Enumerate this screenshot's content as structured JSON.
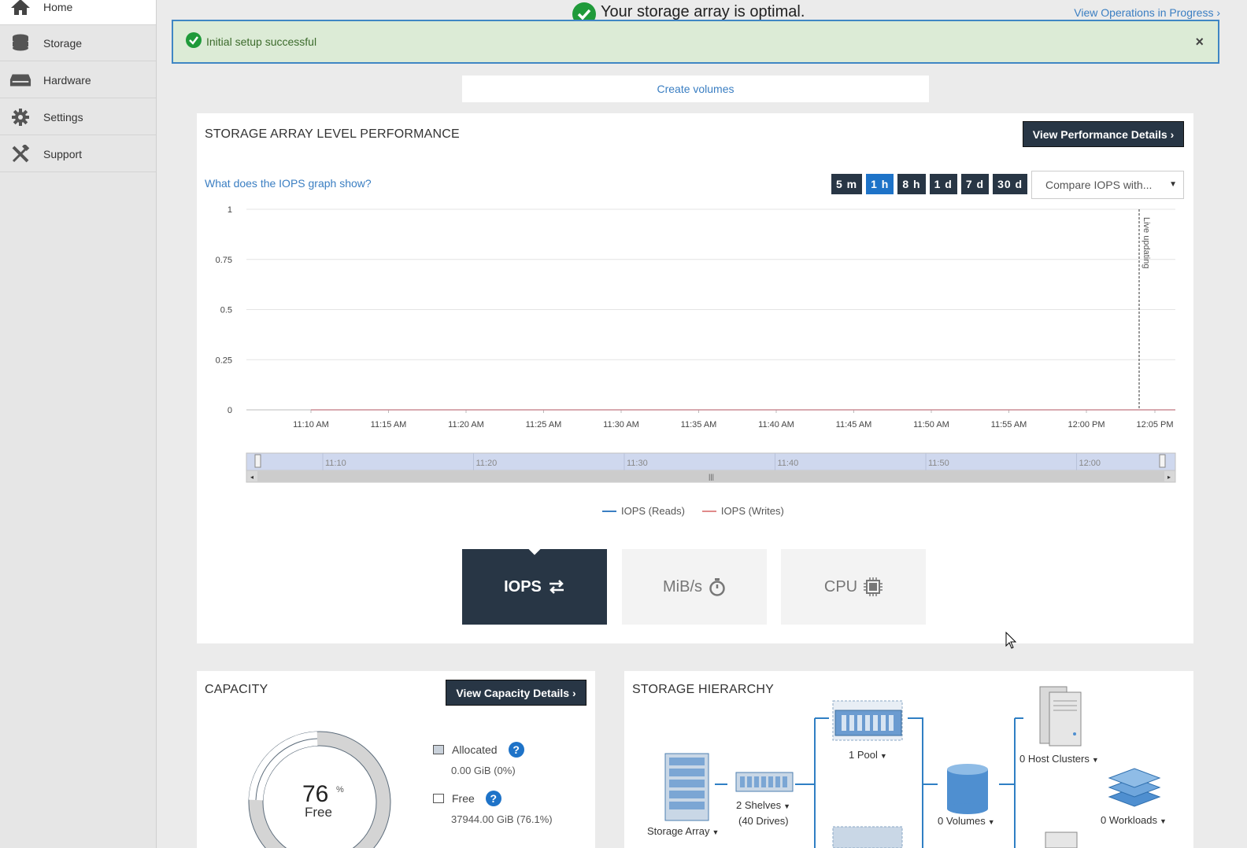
{
  "sidebar": {
    "items": [
      {
        "label": "Home",
        "icon": "home-icon"
      },
      {
        "label": "Storage",
        "icon": "storage-icon"
      },
      {
        "label": "Hardware",
        "icon": "hardware-icon"
      },
      {
        "label": "Settings",
        "icon": "gear-icon"
      },
      {
        "label": "Support",
        "icon": "support-icon"
      }
    ]
  },
  "header": {
    "status_text": "Your storage array is optimal.",
    "operations_link": "View Operations in Progress ›"
  },
  "banner": {
    "message": "Initial setup successful",
    "close_label": "×"
  },
  "create_volumes_label": "Create volumes",
  "performance": {
    "title": "STORAGE ARRAY LEVEL PERFORMANCE",
    "details_button": "View Performance Details ›",
    "help_link": "What does the IOPS graph show?",
    "ranges": [
      "5 m",
      "1 h",
      "8 h",
      "1 d",
      "7 d",
      "30 d"
    ],
    "active_range": "1 h",
    "compare_placeholder": "Compare IOPS with...",
    "live_label": "Live updating",
    "navigator_ticks": [
      "11:10",
      "11:20",
      "11:30",
      "11:40",
      "11:50",
      "12:00"
    ],
    "metrics": [
      {
        "label": "IOPS",
        "icon": "swap-arrows-icon",
        "active": true
      },
      {
        "label": "MiB/s",
        "icon": "stopwatch-icon",
        "active": false
      },
      {
        "label": "CPU",
        "icon": "cpu-chip-icon",
        "active": false
      }
    ]
  },
  "chart_data": {
    "type": "line",
    "x": [
      "11:10 AM",
      "11:15 AM",
      "11:20 AM",
      "11:25 AM",
      "11:30 AM",
      "11:35 AM",
      "11:40 AM",
      "11:45 AM",
      "11:50 AM",
      "11:55 AM",
      "12:00 PM",
      "12:05 PM"
    ],
    "yticks": [
      "0",
      "0.25",
      "0.5",
      "0.75",
      "1"
    ],
    "ylim": [
      0,
      1
    ],
    "series": [
      {
        "name": "IOPS (Reads)",
        "color": "#3a7ec2",
        "values": [
          0,
          0,
          0,
          0,
          0,
          0,
          0,
          0,
          0,
          0,
          0,
          0
        ]
      },
      {
        "name": "IOPS (Writes)",
        "color": "#e08a8a",
        "values": [
          0,
          0,
          0,
          0,
          0,
          0,
          0,
          0,
          0,
          0,
          0,
          0
        ]
      }
    ],
    "grid": true,
    "legend": "bottom"
  },
  "capacity": {
    "title": "CAPACITY",
    "details_button": "View Capacity Details ›",
    "free_percent": "76",
    "percent_sign": "%",
    "free_label": "Free",
    "allocated_label": "Allocated",
    "allocated_value": "0.00 GiB (0%)",
    "free_legend_label": "Free",
    "free_value": "37944.00 GiB (76.1%)",
    "help_glyph": "?"
  },
  "hierarchy": {
    "title": "STORAGE HIERARCHY",
    "storage_array": "Storage Array",
    "shelves": "2 Shelves",
    "drives": "(40 Drives)",
    "pool": "1 Pool",
    "volumes": "0 Volumes",
    "host_clusters": "0 Host Clusters",
    "workloads": "0 Workloads"
  },
  "colors": {
    "accent": "#1e73c8",
    "dark": "#283645",
    "success_bg": "#dcebd6",
    "success_icon": "#1f9a3a",
    "link": "#3a7ec2"
  }
}
